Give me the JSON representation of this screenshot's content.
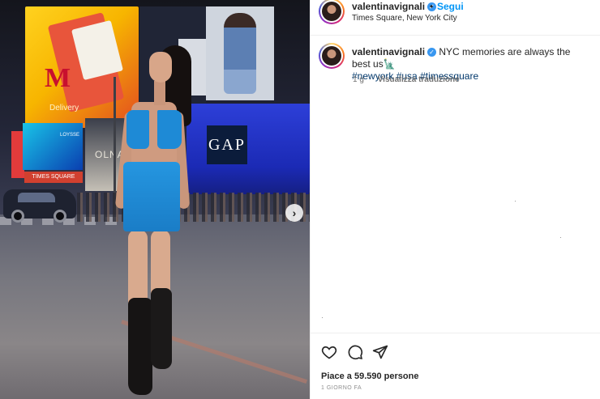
{
  "post": {
    "username": "valentinavignali",
    "separator": "•",
    "follow_label": "Segui",
    "location": "Times Square, New York City"
  },
  "caption": {
    "username": "valentinavignali",
    "text": "NYC memories are always the best us",
    "text_emoji": "🗽",
    "hashtags": [
      "#newyork",
      "#usa",
      "#timessquare"
    ],
    "age": "1 g",
    "translate_label": "Visualizza traduzione"
  },
  "photo": {
    "mcd_logo": "M",
    "mcd_text": "Delivery",
    "gap_logo": "GAP",
    "store_sign": "OLNA",
    "sign_text": "TIMES SQUARE",
    "tv_text": "LOYSSE",
    "next_glyph": "›"
  },
  "footer": {
    "likes": "Piace a 59.590 persone",
    "time_ago": "1 GIORNO FA"
  },
  "icons": [
    "heart-icon",
    "comment-icon",
    "share-icon",
    "verified-badge-icon",
    "next-arrow-icon"
  ]
}
